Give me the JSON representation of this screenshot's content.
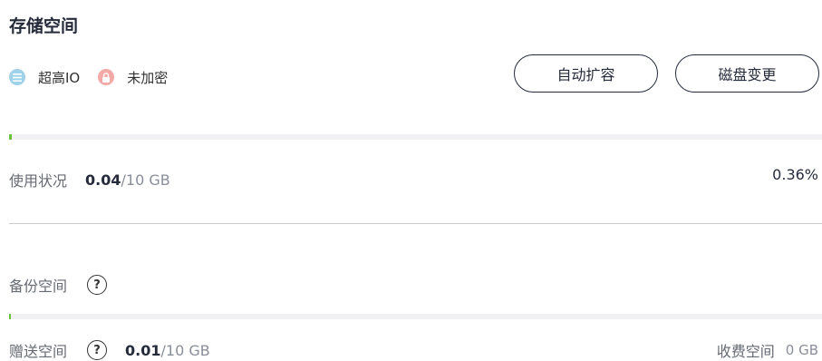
{
  "section": {
    "title": "存储空间"
  },
  "tags": {
    "io_type": "超高IO",
    "encryption": "未加密"
  },
  "buttons": {
    "auto_expand": "自动扩容",
    "disk_change": "磁盘变更"
  },
  "usage": {
    "label": "使用状况",
    "used": "0.04",
    "total": "/10 GB",
    "percent": "0.36%",
    "fraction": 0.0036
  },
  "backup": {
    "label": "备份空间",
    "help": "?",
    "free_label": "赠送空间",
    "free_used": "0.01",
    "free_total": "/10 GB",
    "charged_label": "收费空间",
    "charged_value": "0 GB",
    "fraction": 0.001
  },
  "colors": {
    "accent": "#69c33c",
    "io_icon": "#9ed2ea",
    "lock_icon": "#f3a9a5"
  }
}
